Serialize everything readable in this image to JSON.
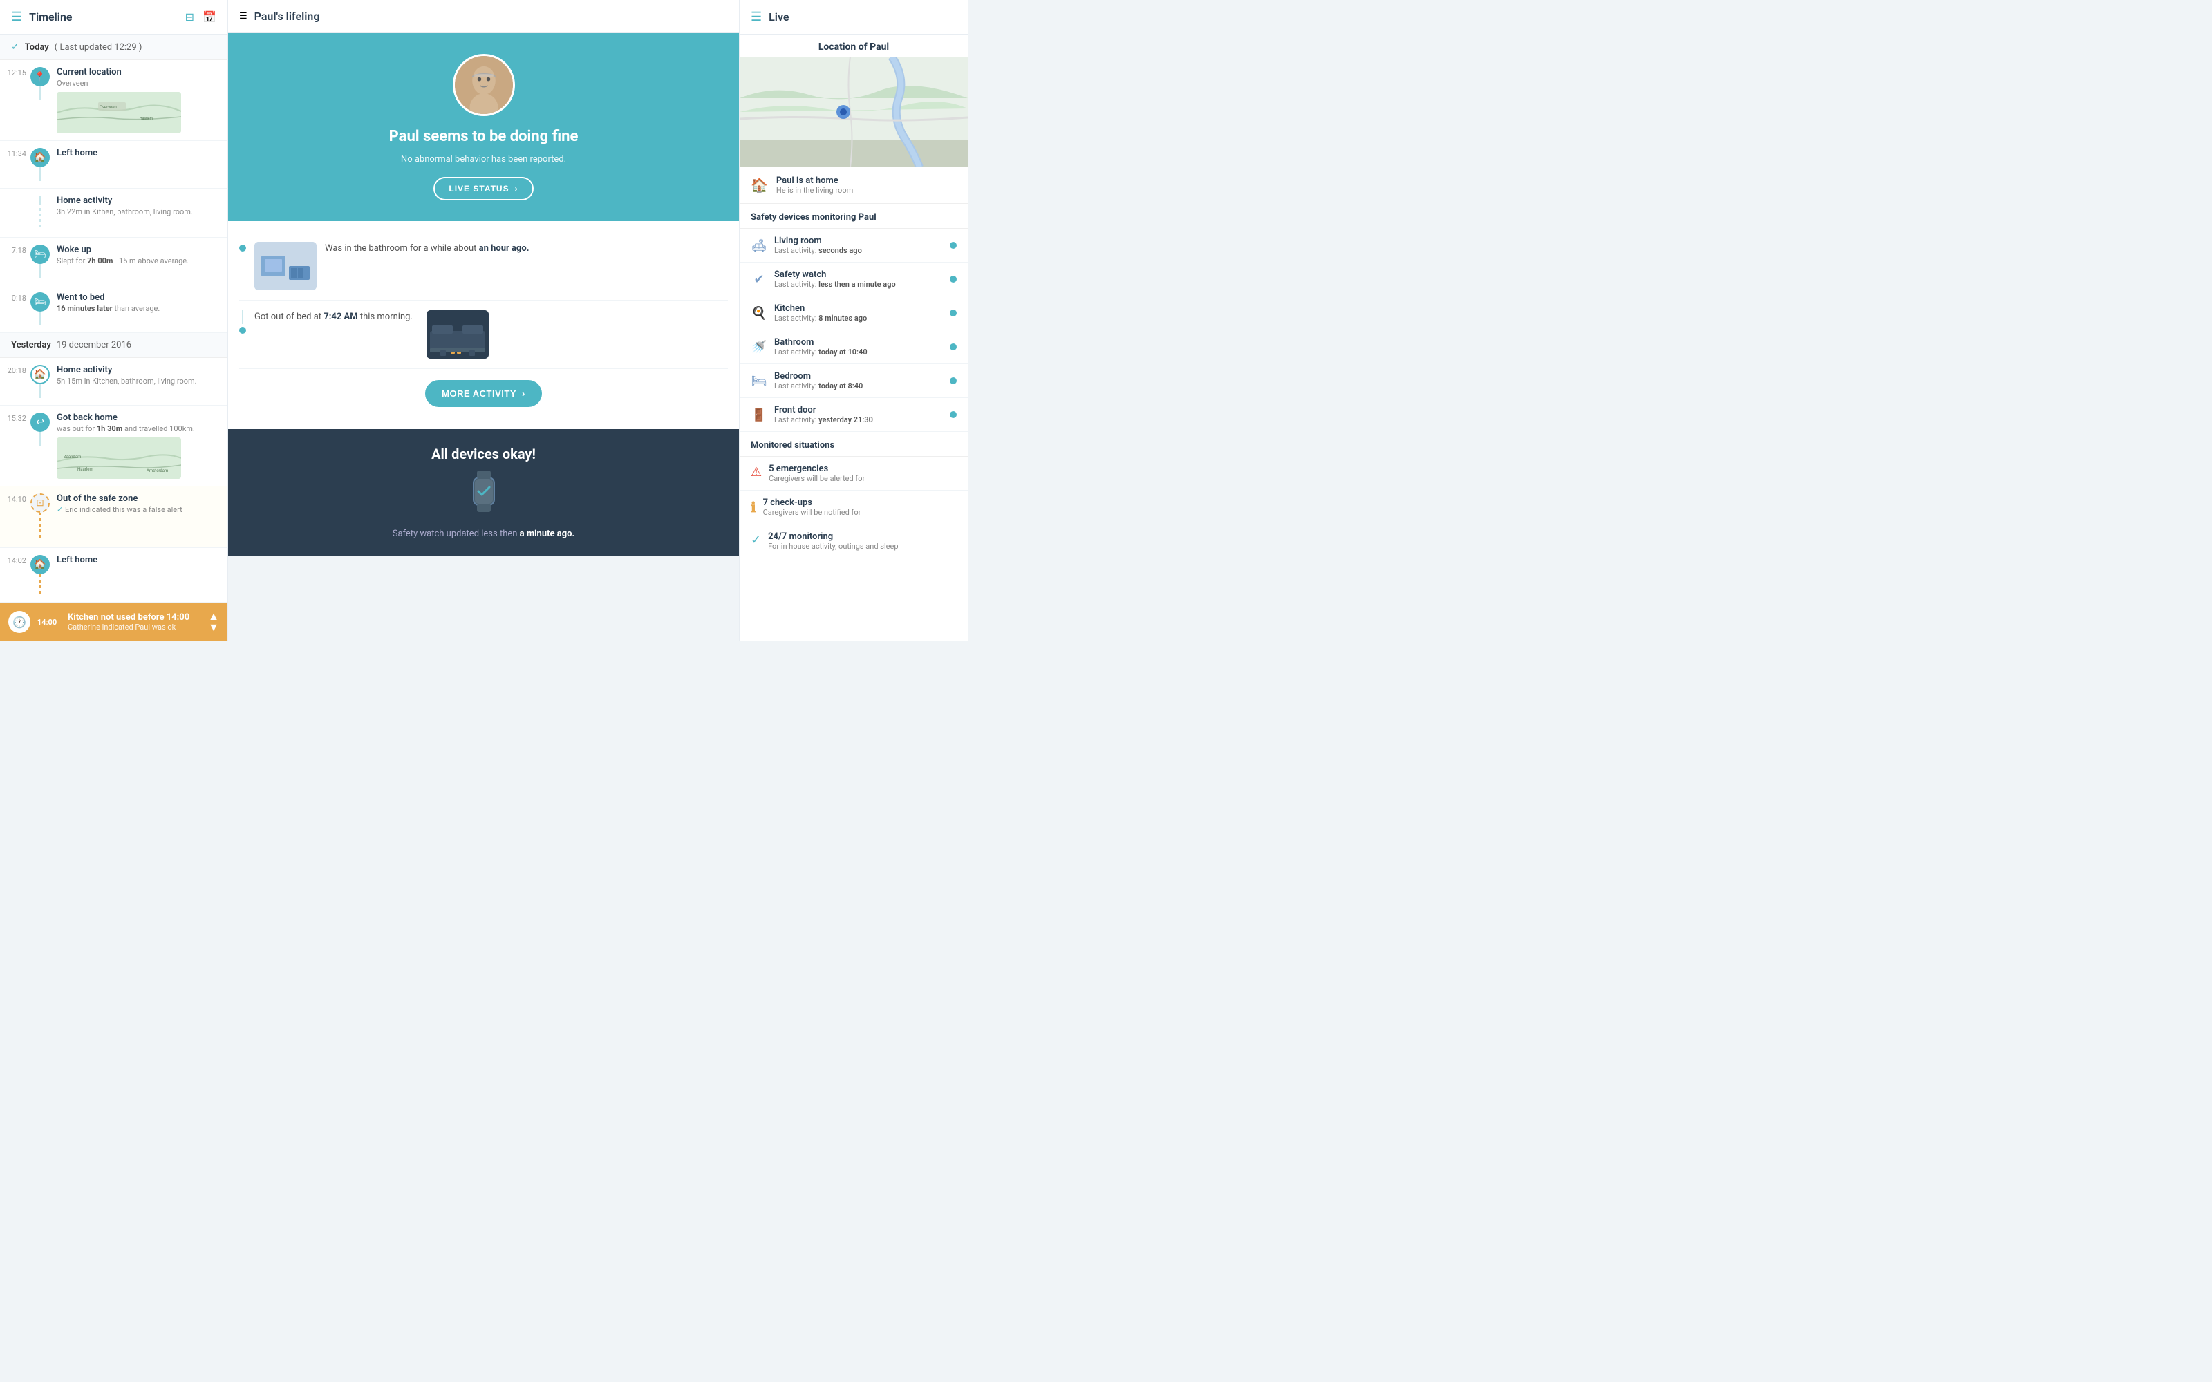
{
  "left": {
    "header": {
      "menu_label": "☰",
      "title": "Timeline",
      "filter_icon": "⊟",
      "calendar_icon": "📅"
    },
    "today_header": {
      "check": "✓",
      "label": "Today",
      "sub": "( Last updated 12:29 )"
    },
    "items": [
      {
        "time": "12:15",
        "icon": "📍",
        "icon_type": "green",
        "title": "Current location",
        "sub": "Overveen",
        "has_map": true,
        "connector": "solid"
      },
      {
        "time": "11:34",
        "icon": "🏠",
        "icon_type": "green",
        "title": "Left home",
        "sub": "",
        "connector": "solid"
      },
      {
        "time": "",
        "icon": "",
        "icon_type": "line",
        "title": "Home activity",
        "sub": "3h 22m in Kithen, bathroom, living room.",
        "connector": "dashed"
      },
      {
        "time": "7:18",
        "icon": "🛏",
        "icon_type": "green",
        "title": "Woke up",
        "sub": "Slept for 7h 00m - 15 m above average.",
        "connector": "solid"
      },
      {
        "time": "0:18",
        "icon": "🛏",
        "icon_type": "green",
        "title": "Went to bed",
        "sub": "16 minutes later than average.",
        "connector": "solid"
      }
    ],
    "yesterday_header": {
      "label": "Yesterday",
      "date": "19 december 2016"
    },
    "yesterday_items": [
      {
        "time": "20:18",
        "icon": "🏠",
        "icon_type": "outline",
        "title": "Home activity",
        "sub": "5h 15m in Kitchen, bathroom, living room.",
        "connector": "solid"
      },
      {
        "time": "15:32",
        "icon": "←",
        "icon_type": "green",
        "title": "Got back home",
        "sub": "was out for 1h 30m and travelled 100km.",
        "has_map": true,
        "connector": "solid"
      },
      {
        "time": "14:10",
        "icon": "⊡",
        "icon_type": "orange_outline",
        "title": "Out of the safe zone",
        "sub_check": "✓",
        "sub": "Eric indicated this was a false alert",
        "connector": "orange_dashed"
      },
      {
        "time": "14:02",
        "icon": "🏠",
        "icon_type": "green",
        "title": "Left home",
        "sub": "",
        "connector": "orange_dashed"
      }
    ],
    "alert": {
      "time": "14:00",
      "title": "Kitchen not used before 14:00",
      "sub": "Catherine indicated Paul was ok",
      "chevron_up": "▲",
      "chevron_down": "▼"
    }
  },
  "center": {
    "header": {
      "menu_label": "☰",
      "title": "Paul's lifeling"
    },
    "profile": {
      "status": "Paul seems to be doing fine",
      "desc": "No abnormal behavior has been reported.",
      "live_btn": "LIVE STATUS",
      "live_chevron": "›"
    },
    "activities": [
      {
        "text_pre": "Was in the bathroom for a while about",
        "text_bold": "an hour ago.",
        "thumb_type": "bathroom"
      },
      {
        "text_pre": "Got out of bed at",
        "text_bold": "7:42 AM",
        "text_post": "this morning.",
        "thumb_type": "bedroom"
      }
    ],
    "more_btn": "MORE ACTIVITY",
    "more_chevron": "›",
    "devices": {
      "title": "All devices okay!",
      "sub_pre": "Safety watch updated less then",
      "sub_bold": "a minute ago."
    }
  },
  "right": {
    "header": {
      "menu_label": "☰",
      "title": "Live"
    },
    "location": {
      "section_title": "Location of Paul",
      "icon": "🏠",
      "title": "Paul is at home",
      "sub": "He is in the living room"
    },
    "devices_section": "Safety devices monitoring Paul",
    "devices": [
      {
        "icon": "🛋",
        "name": "Living room",
        "last_label": "Last activity:",
        "last_val": "seconds ago"
      },
      {
        "icon": "⌚",
        "name": "Safety watch",
        "last_label": "Last activity:",
        "last_val": "less then a minute ago"
      },
      {
        "icon": "🍳",
        "name": "Kitchen",
        "last_label": "Last activity:",
        "last_val": "8 minutes ago"
      },
      {
        "icon": "🚿",
        "name": "Bathroom",
        "last_label": "Last activity:",
        "last_val": "today at 10:40"
      },
      {
        "icon": "🛏",
        "name": "Bedroom",
        "last_label": "Last activity:",
        "last_val": "today at 8:40"
      },
      {
        "icon": "🚪",
        "name": "Front door",
        "last_label": "Last activity:",
        "last_val": "yesterday 21:30"
      }
    ],
    "monitored_section": "Monitored situations",
    "monitored": [
      {
        "icon_type": "red",
        "icon": "⚠",
        "name": "5 emergencies",
        "sub": "Caregivers will be alerted for"
      },
      {
        "icon_type": "orange",
        "icon": "ℹ",
        "name": "7 check-ups",
        "sub": "Caregivers will be notified for"
      },
      {
        "icon_type": "green",
        "icon": "✓",
        "name": "24/7 monitoring",
        "sub": "For in house activity, outings and sleep"
      }
    ]
  }
}
